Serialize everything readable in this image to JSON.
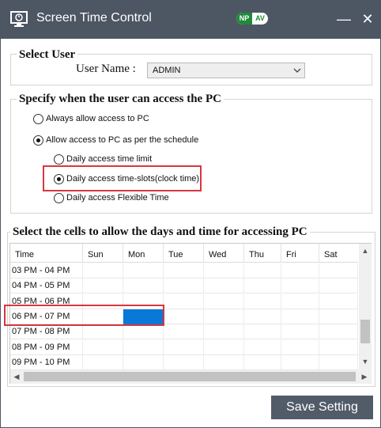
{
  "window": {
    "title": "Screen Time Control",
    "badge_left": "NP",
    "badge_right": "AV",
    "minimize_glyph": "—",
    "close_glyph": "✕"
  },
  "select_user": {
    "legend": "Select User",
    "label": "User Name :",
    "value": "ADMIN"
  },
  "access": {
    "legend": "Specify when the user can access the PC",
    "options": [
      {
        "label": "Always allow access to PC",
        "selected": false
      },
      {
        "label": "Allow access to PC as per the schedule",
        "selected": true
      }
    ],
    "sub_options": [
      {
        "label": "Daily access time limit",
        "selected": false
      },
      {
        "label": "Daily access time-slots(clock time)",
        "selected": true
      },
      {
        "label": "Daily access Flexible Time",
        "selected": false
      }
    ]
  },
  "schedule": {
    "legend": "Select the cells to allow the days and time for accessing PC",
    "columns": [
      "Time",
      "Sun",
      "Mon",
      "Tue",
      "Wed",
      "Thu",
      "Fri",
      "Sat"
    ],
    "rows": [
      {
        "time": "03 PM - 04 PM",
        "selected_days": []
      },
      {
        "time": "04 PM - 05 PM",
        "selected_days": []
      },
      {
        "time": "05 PM - 06 PM",
        "selected_days": []
      },
      {
        "time": "06 PM - 07 PM",
        "selected_days": [
          "Mon"
        ]
      },
      {
        "time": "07 PM - 08 PM",
        "selected_days": []
      },
      {
        "time": "08 PM - 09 PM",
        "selected_days": []
      },
      {
        "time": "09 PM - 10 PM",
        "selected_days": []
      }
    ],
    "selected_color": "#0a78d7"
  },
  "save_label": "Save Setting",
  "colors": {
    "titlebar": "#4d5663",
    "highlight": "#d9363e",
    "button": "#525c69"
  }
}
